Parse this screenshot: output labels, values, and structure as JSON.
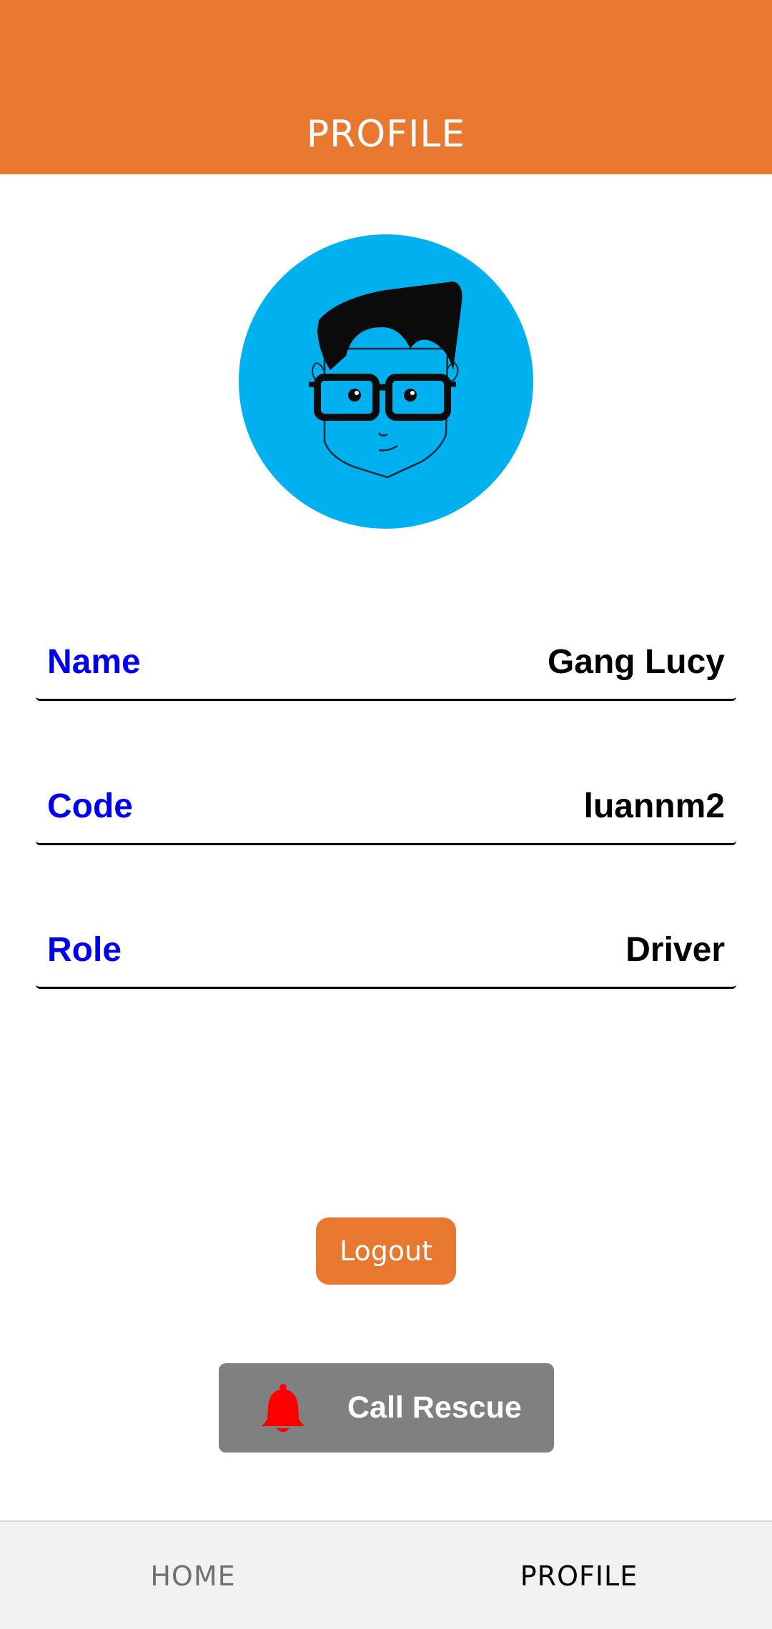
{
  "header": {
    "title": "PROFILE"
  },
  "profile": {
    "avatar_icon": "cartoon-avatar-icon",
    "fields": [
      {
        "label": "Name",
        "value": "Gang Lucy"
      },
      {
        "label": "Code",
        "value": "luannm2"
      },
      {
        "label": "Role",
        "value": "Driver"
      }
    ]
  },
  "actions": {
    "logout_label": "Logout",
    "rescue_label": "Call Rescue",
    "rescue_icon": "bell-icon"
  },
  "tabbar": {
    "tabs": [
      {
        "label": "HOME",
        "active": false
      },
      {
        "label": "PROFILE",
        "active": true
      }
    ]
  },
  "colors": {
    "header": "#E8782F",
    "avatar_bg": "#00B0EF",
    "label": "#0000EE",
    "rescue_bg": "#808080",
    "bell": "#FF0000"
  }
}
